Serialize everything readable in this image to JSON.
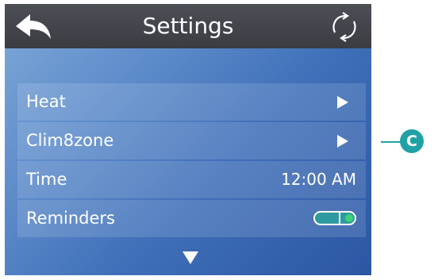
{
  "header": {
    "title": "Settings",
    "back_icon": "back-arrow-icon",
    "refresh_icon": "refresh-icon"
  },
  "menu": {
    "items": [
      {
        "label": "Heat",
        "control": "chevron"
      },
      {
        "label": "Clim8zone",
        "control": "chevron"
      },
      {
        "label": "Time",
        "value": "12:00 AM"
      },
      {
        "label": "Reminders",
        "control": "toggle",
        "toggle_on": true
      }
    ]
  },
  "scroll": {
    "icon": "down-arrow-icon"
  },
  "callout": {
    "label": "C",
    "color": "#20a1a5"
  },
  "colors": {
    "header_bg": "#3f4147",
    "toggle_track": "#2f9aa0",
    "toggle_knob": "#3ed07a"
  }
}
